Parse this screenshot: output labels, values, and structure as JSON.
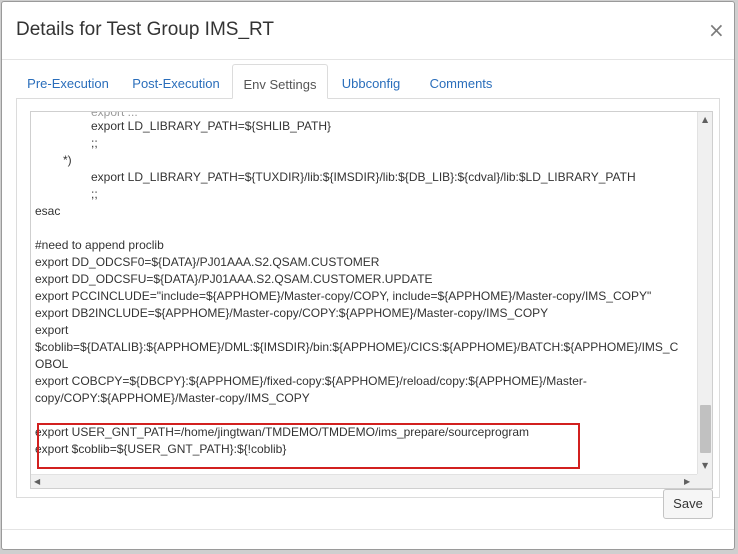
{
  "dialog": {
    "title": "Details for Test Group IMS_RT",
    "close_glyph": "×",
    "close_icon": "close-icon"
  },
  "tabs": [
    {
      "label": "Pre-Execution",
      "active": false
    },
    {
      "label": "Post-Execution",
      "active": false
    },
    {
      "label": "Env Settings",
      "active": true
    },
    {
      "label": "Ubbconfig",
      "active": false
    },
    {
      "label": "Comments",
      "active": false
    }
  ],
  "editor": {
    "lines": [
      "export LD_LIBRARY_PATH=${SHLIB_PATH}",
      ";;",
      "*)",
      "export LD_LIBRARY_PATH=${TUXDIR}/lib:${IMSDIR}/lib:${DB_LIB}:${cdval}/lib:$LD_LIBRARY_PATH",
      ";;",
      "esac",
      "",
      "#need to append proclib",
      "export DD_ODCSF0=${DATA}/PJ01AAA.S2.QSAM.CUSTOMER",
      "export DD_ODCSFU=${DATA}/PJ01AAA.S2.QSAM.CUSTOMER.UPDATE",
      "export PCCINCLUDE=\"include=${APPHOME}/Master-copy/COPY, include=${APPHOME}/Master-copy/IMS_COPY\"",
      "export DB2INCLUDE=${APPHOME}/Master-copy/COPY:${APPHOME}/Master-copy/IMS_COPY",
      "export",
      "$coblib=${DATALIB}:${APPHOME}/DML:${IMSDIR}/bin:${APPHOME}/CICS:${APPHOME}/BATCH:${APPHOME}/IMS_C",
      "OBOL",
      "export COBCPY=${DBCPY}:${APPHOME}/fixed-copy:${APPHOME}/reload/copy:${APPHOME}/Master-",
      "copy/COPY:${APPHOME}/Master-copy/IMS_COPY",
      "",
      "export USER_GNT_PATH=/home/jingtwan/TMDEMO/TMDEMO/ims_prepare/sourceprogram",
      "export $coblib=${USER_GNT_PATH}:${!coblib}"
    ],
    "scroll_up_glyph": "▲",
    "scroll_down_glyph": "▼",
    "scroll_left_glyph": "◀",
    "scroll_right_glyph": "▶"
  },
  "buttons": {
    "save_label": "Save"
  },
  "colors": {
    "link": "#2a6ebb",
    "highlight": "#d2201f"
  }
}
